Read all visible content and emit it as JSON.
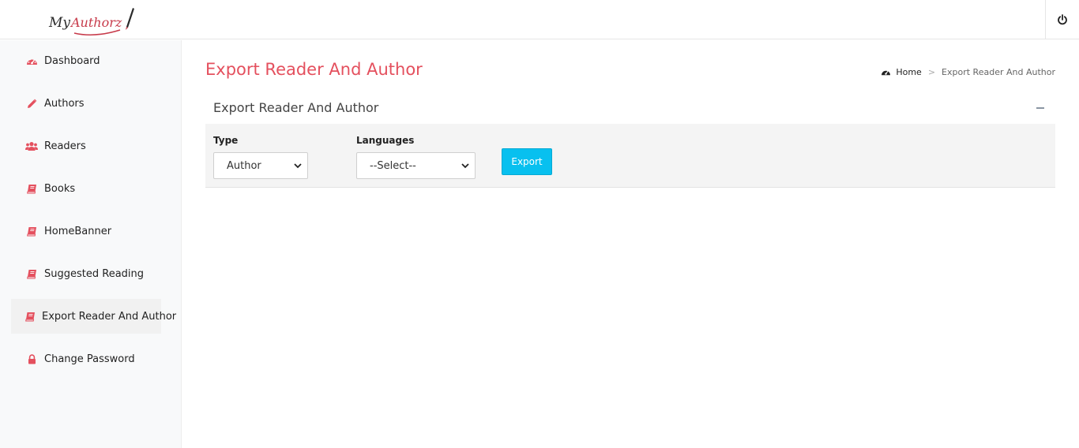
{
  "app": {
    "logo_text": "My Authorz",
    "power_icon": "power-icon"
  },
  "colors": {
    "accent": "#e4505e",
    "button": "#08c0ef"
  },
  "sidebar": {
    "items": [
      {
        "label": "Dashboard",
        "icon": "dashboard-icon",
        "active": false
      },
      {
        "label": "Authors",
        "icon": "pencil-icon",
        "active": false
      },
      {
        "label": "Readers",
        "icon": "users-icon",
        "active": false
      },
      {
        "label": "Books",
        "icon": "book-icon",
        "active": false
      },
      {
        "label": "HomeBanner",
        "icon": "book-icon",
        "active": false
      },
      {
        "label": "Suggested Reading",
        "icon": "book-icon",
        "active": false
      },
      {
        "label": "Export Reader And Author",
        "icon": "book-icon",
        "active": true
      },
      {
        "label": "Change Password",
        "icon": "lock-icon",
        "active": false
      }
    ]
  },
  "header": {
    "title": "Export Reader And Author",
    "breadcrumb": {
      "home": "Home",
      "separator": ">",
      "current": "Export Reader And Author"
    }
  },
  "card": {
    "title": "Export Reader And Author",
    "type_label": "Type",
    "type_value": "Author",
    "languages_label": "Languages",
    "languages_value": "--Select--",
    "export_label": "Export"
  }
}
